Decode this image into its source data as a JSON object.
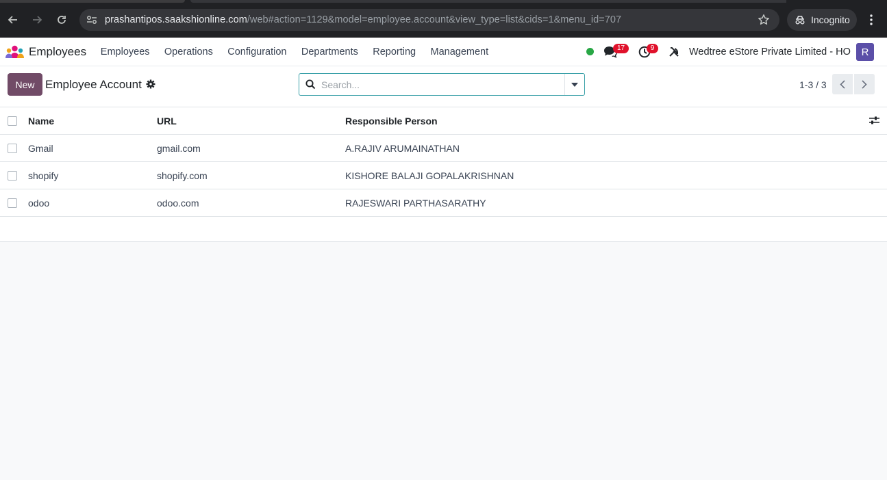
{
  "browser": {
    "url_host": "prashantipos.saakshionline.com",
    "url_rest": "/web#action=1129&model=employee.account&view_type=list&cids=1&menu_id=707",
    "incognito_label": "Incognito"
  },
  "navbar": {
    "app_name": "Employees",
    "menu": [
      "Employees",
      "Operations",
      "Configuration",
      "Departments",
      "Reporting",
      "Management"
    ],
    "messages_count": "17",
    "activities_count": "9",
    "company": "Wedtree eStore Private Limited - HO",
    "avatar_letter": "R"
  },
  "control_panel": {
    "new_label": "New",
    "title": "Employee Account",
    "search_placeholder": "Search...",
    "pager": "1-3 / 3"
  },
  "table": {
    "headers": {
      "name": "Name",
      "url": "URL",
      "responsible": "Responsible Person"
    },
    "rows": [
      {
        "name": "Gmail",
        "url": "gmail.com",
        "responsible": "A.RAJIV ARUMAINATHAN"
      },
      {
        "name": "shopify",
        "url": "shopify.com",
        "responsible": "KISHORE BALAJI GOPALAKRISHNAN"
      },
      {
        "name": "odoo",
        "url": "odoo.com",
        "responsible": "RAJESWARI PARTHASARATHY"
      }
    ]
  },
  "colors": {
    "brand": "#714b67",
    "badge": "#e0112b",
    "online": "#28a745",
    "avatar": "#5b4fa8"
  }
}
